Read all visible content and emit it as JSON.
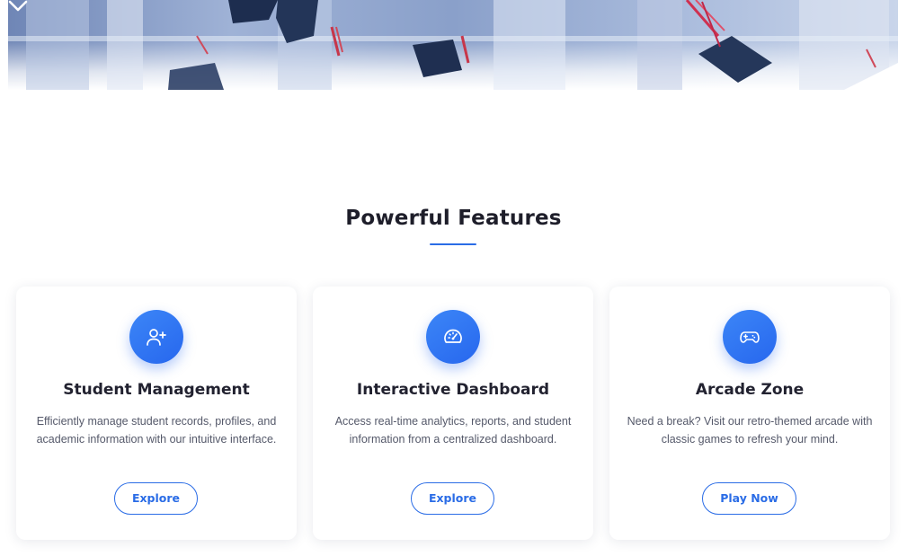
{
  "hero": {
    "scroll_indicator_icon": "chevron-down-icon"
  },
  "features": {
    "title": "Powerful Features",
    "accent_color": "#2a6ce6",
    "cards": [
      {
        "icon": "user-plus-icon",
        "title": "Student Management",
        "description": "Efficiently manage student records, profiles, and academic information with our intuitive interface.",
        "button_label": "Explore"
      },
      {
        "icon": "gauge-icon",
        "title": "Interactive Dashboard",
        "description": "Access real-time analytics, reports, and student information from a centralized dashboard.",
        "button_label": "Explore"
      },
      {
        "icon": "gamepad-icon",
        "title": "Arcade Zone",
        "description": "Need a break? Visit our retro-themed arcade with classic games to refresh your mind.",
        "button_label": "Play Now"
      }
    ]
  }
}
